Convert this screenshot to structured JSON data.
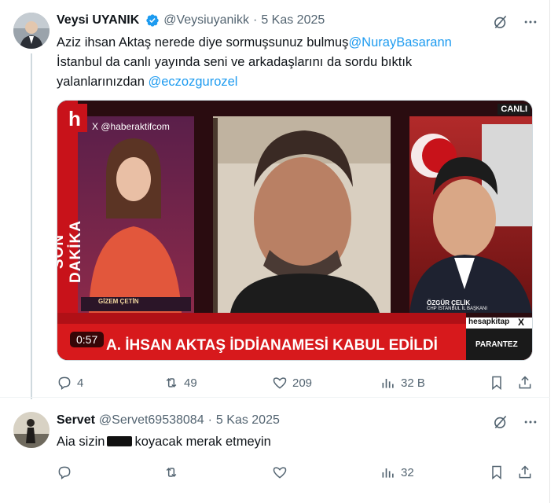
{
  "tweet": {
    "author_name": "Veysi UYANIK",
    "handle": "@Veysiuyanikk",
    "separator": "·",
    "date": "5 Kas 2025",
    "text_part1": "Aziz ihsan Aktaş nerede diye sormuşsunuz bulmuş",
    "mention1": "@NurayBasarann",
    "text_part2": "İstanbul da canlı yayında seni ve arkadaşlarını da sordu bıktık",
    "text_part3": "yalanlarınızdan ",
    "mention2": "@eczozgurozel",
    "media": {
      "duration": "0:57",
      "channel_watermark": "X @haberaktifcom",
      "live_label": "CANLI",
      "side_banner": "SON DAKİKA",
      "left_person_caption": "GİZEM ÇETİN",
      "right_person_caption": "ÖZGÜR ÇELİK",
      "right_person_subcaption": "CHP İSTANBUL İL BAŞKANI",
      "headline": "A. İHSAN AKTAŞ İDDİANAMESİ KABUL EDİLDİ",
      "program_name": "PARANTEZ",
      "sponsor": "hesapkitap",
      "x_mark": "X"
    },
    "stats": {
      "replies": "4",
      "reposts": "49",
      "likes": "209",
      "views": "32 B"
    }
  },
  "reply": {
    "author_name": "Servet",
    "handle": "@Servet69538084",
    "separator": "·",
    "date": "5 Kas 2025",
    "text_before": "Aia sizin",
    "text_after": "koyacak merak etmeyin",
    "stats": {
      "views": "32"
    }
  },
  "colors": {
    "accent": "#1d9bf0",
    "secondary_text": "#536471",
    "breaking_red": "#d7191c"
  }
}
